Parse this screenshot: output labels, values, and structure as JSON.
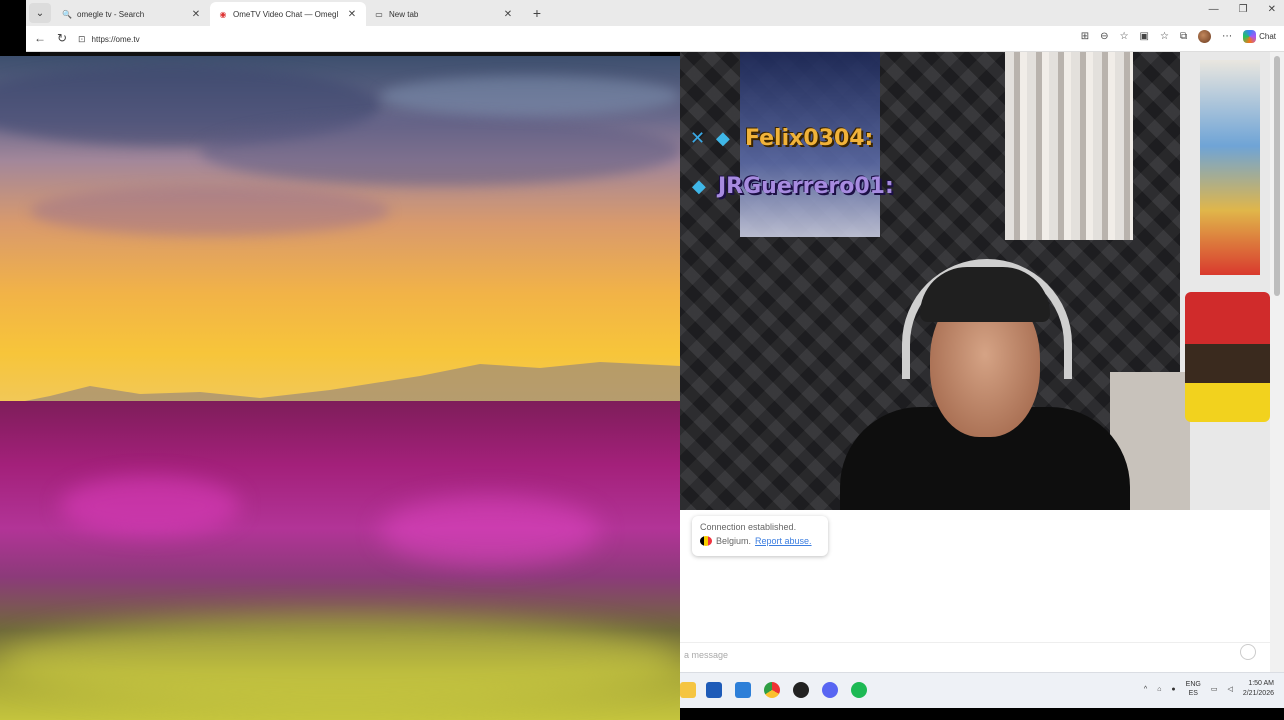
{
  "browser": {
    "tabs": [
      {
        "title": "omegle tv - Search",
        "icon": "search-icon",
        "active": false
      },
      {
        "title": "OmeTV Video Chat — Omegl",
        "icon": "record-icon",
        "active": true
      },
      {
        "title": "New tab",
        "icon": "newtab-icon",
        "active": false
      }
    ],
    "url": "https://ome.tv",
    "chat_label": "Chat"
  },
  "video": {
    "overlay_names": [
      "Felix0304:",
      "JRGuerrero01:"
    ]
  },
  "chat": {
    "connection_text": "Connection established.",
    "country": "Belgium.",
    "report_text": "Report abuse.",
    "message_placeholder": "a message"
  },
  "taskbar": {
    "lang_top": "ENG",
    "lang_bottom": "ES",
    "time": "1:50 AM",
    "date": "2/21/2026"
  },
  "colors": {
    "accent_link": "#3c7ee0",
    "name1": "#f1b33a",
    "name2": "#a78be0"
  }
}
